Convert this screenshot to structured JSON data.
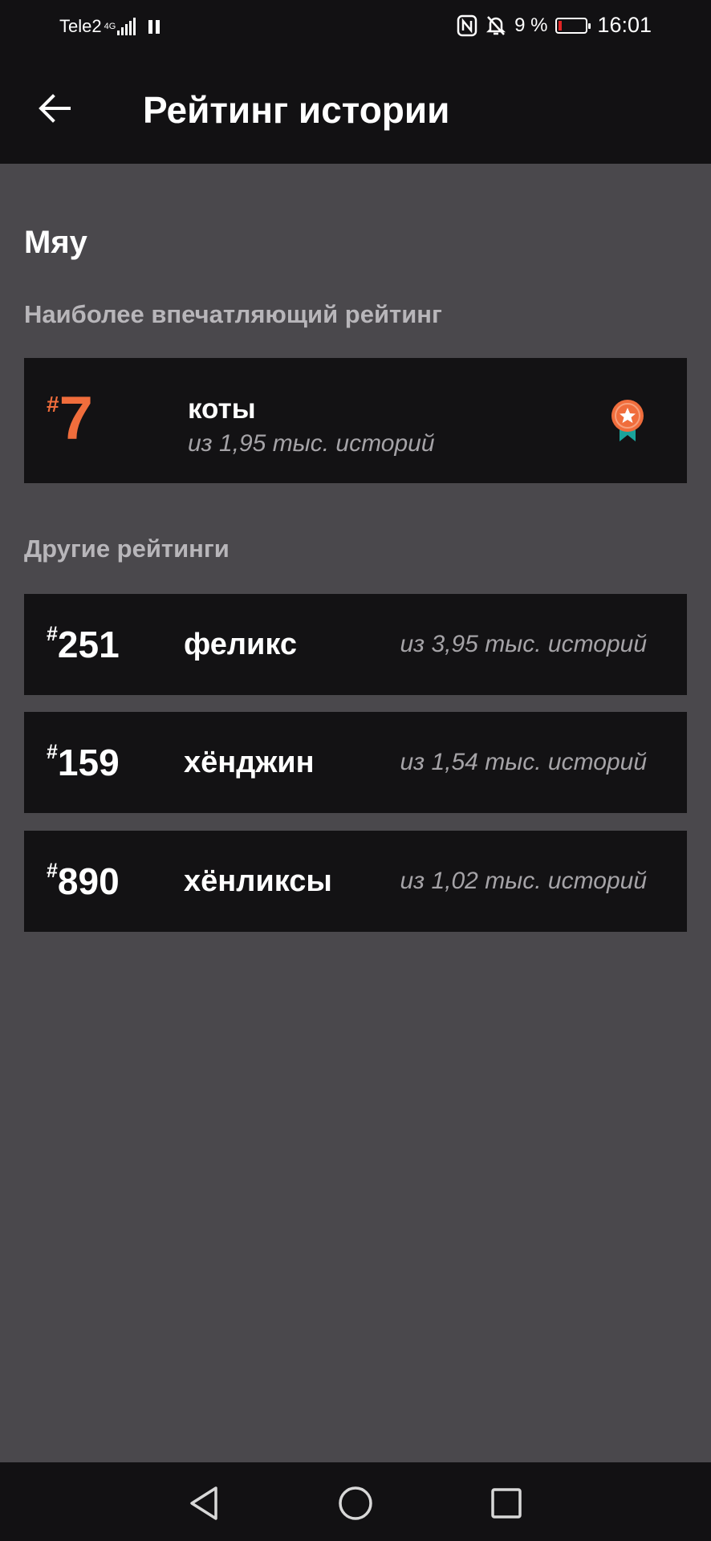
{
  "status_bar": {
    "carrier": "Tele2",
    "network": "4G",
    "battery": "9 %",
    "battery_level": 0.09,
    "time": "16:01"
  },
  "app_bar": {
    "title": "Рейтинг истории",
    "back_icon": "arrow-back-icon"
  },
  "story": {
    "title": "Мяу"
  },
  "best_section": {
    "label": "Наиболее впечатляющий рейтинг",
    "card": {
      "hash": "#",
      "rank": "7",
      "tag": "коты",
      "count": "из 1,95 тыс. историй",
      "icon": "award-medal-icon"
    }
  },
  "other_section": {
    "label": "Другие рейтинги",
    "items": [
      {
        "hash": "#",
        "rank": "251",
        "tag": "феликс",
        "count": "из 3,95 тыс. историй"
      },
      {
        "hash": "#",
        "rank": "159",
        "tag": "хёнджин",
        "count": "из 1,54 тыс. историй"
      },
      {
        "hash": "#",
        "rank": "890",
        "tag": "хёнликсы",
        "count": "из 1,02 тыс. историй"
      }
    ]
  },
  "colors": {
    "accent": "#f06d3c",
    "background": "#4a484c",
    "card": "#131214",
    "bar": "#121113",
    "ribbon": "#1aa39b"
  },
  "nav_bar": {
    "icons": [
      "nav-back-icon",
      "nav-home-icon",
      "nav-recent-icon"
    ]
  }
}
